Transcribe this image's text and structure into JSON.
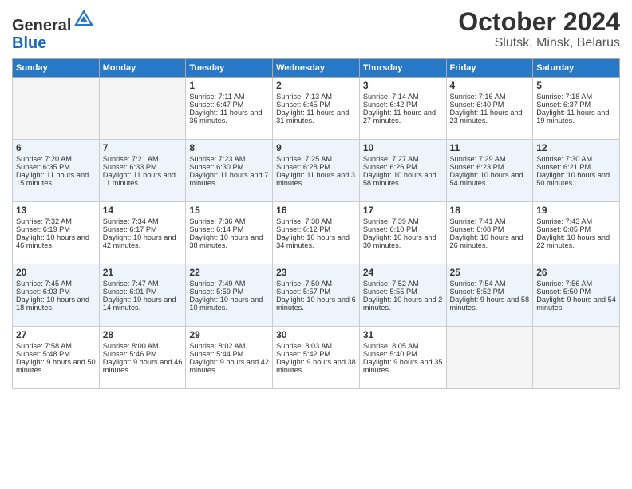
{
  "logo": {
    "general": "General",
    "blue": "Blue"
  },
  "title": "October 2024",
  "subtitle": "Slutsk, Minsk, Belarus",
  "days_header": [
    "Sunday",
    "Monday",
    "Tuesday",
    "Wednesday",
    "Thursday",
    "Friday",
    "Saturday"
  ],
  "weeks": [
    [
      {
        "day": "",
        "content": ""
      },
      {
        "day": "",
        "content": ""
      },
      {
        "day": "1",
        "content": "Sunrise: 7:11 AM\nSunset: 6:47 PM\nDaylight: 11 hours and 36 minutes."
      },
      {
        "day": "2",
        "content": "Sunrise: 7:13 AM\nSunset: 6:45 PM\nDaylight: 11 hours and 31 minutes."
      },
      {
        "day": "3",
        "content": "Sunrise: 7:14 AM\nSunset: 6:42 PM\nDaylight: 11 hours and 27 minutes."
      },
      {
        "day": "4",
        "content": "Sunrise: 7:16 AM\nSunset: 6:40 PM\nDaylight: 11 hours and 23 minutes."
      },
      {
        "day": "5",
        "content": "Sunrise: 7:18 AM\nSunset: 6:37 PM\nDaylight: 11 hours and 19 minutes."
      }
    ],
    [
      {
        "day": "6",
        "content": "Sunrise: 7:20 AM\nSunset: 6:35 PM\nDaylight: 11 hours and 15 minutes."
      },
      {
        "day": "7",
        "content": "Sunrise: 7:21 AM\nSunset: 6:33 PM\nDaylight: 11 hours and 11 minutes."
      },
      {
        "day": "8",
        "content": "Sunrise: 7:23 AM\nSunset: 6:30 PM\nDaylight: 11 hours and 7 minutes."
      },
      {
        "day": "9",
        "content": "Sunrise: 7:25 AM\nSunset: 6:28 PM\nDaylight: 11 hours and 3 minutes."
      },
      {
        "day": "10",
        "content": "Sunrise: 7:27 AM\nSunset: 6:26 PM\nDaylight: 10 hours and 58 minutes."
      },
      {
        "day": "11",
        "content": "Sunrise: 7:29 AM\nSunset: 6:23 PM\nDaylight: 10 hours and 54 minutes."
      },
      {
        "day": "12",
        "content": "Sunrise: 7:30 AM\nSunset: 6:21 PM\nDaylight: 10 hours and 50 minutes."
      }
    ],
    [
      {
        "day": "13",
        "content": "Sunrise: 7:32 AM\nSunset: 6:19 PM\nDaylight: 10 hours and 46 minutes."
      },
      {
        "day": "14",
        "content": "Sunrise: 7:34 AM\nSunset: 6:17 PM\nDaylight: 10 hours and 42 minutes."
      },
      {
        "day": "15",
        "content": "Sunrise: 7:36 AM\nSunset: 6:14 PM\nDaylight: 10 hours and 38 minutes."
      },
      {
        "day": "16",
        "content": "Sunrise: 7:38 AM\nSunset: 6:12 PM\nDaylight: 10 hours and 34 minutes."
      },
      {
        "day": "17",
        "content": "Sunrise: 7:39 AM\nSunset: 6:10 PM\nDaylight: 10 hours and 30 minutes."
      },
      {
        "day": "18",
        "content": "Sunrise: 7:41 AM\nSunset: 6:08 PM\nDaylight: 10 hours and 26 minutes."
      },
      {
        "day": "19",
        "content": "Sunrise: 7:43 AM\nSunset: 6:05 PM\nDaylight: 10 hours and 22 minutes."
      }
    ],
    [
      {
        "day": "20",
        "content": "Sunrise: 7:45 AM\nSunset: 6:03 PM\nDaylight: 10 hours and 18 minutes."
      },
      {
        "day": "21",
        "content": "Sunrise: 7:47 AM\nSunset: 6:01 PM\nDaylight: 10 hours and 14 minutes."
      },
      {
        "day": "22",
        "content": "Sunrise: 7:49 AM\nSunset: 5:59 PM\nDaylight: 10 hours and 10 minutes."
      },
      {
        "day": "23",
        "content": "Sunrise: 7:50 AM\nSunset: 5:57 PM\nDaylight: 10 hours and 6 minutes."
      },
      {
        "day": "24",
        "content": "Sunrise: 7:52 AM\nSunset: 5:55 PM\nDaylight: 10 hours and 2 minutes."
      },
      {
        "day": "25",
        "content": "Sunrise: 7:54 AM\nSunset: 5:52 PM\nDaylight: 9 hours and 58 minutes."
      },
      {
        "day": "26",
        "content": "Sunrise: 7:56 AM\nSunset: 5:50 PM\nDaylight: 9 hours and 54 minutes."
      }
    ],
    [
      {
        "day": "27",
        "content": "Sunrise: 7:58 AM\nSunset: 5:48 PM\nDaylight: 9 hours and 50 minutes."
      },
      {
        "day": "28",
        "content": "Sunrise: 8:00 AM\nSunset: 5:46 PM\nDaylight: 9 hours and 46 minutes."
      },
      {
        "day": "29",
        "content": "Sunrise: 8:02 AM\nSunset: 5:44 PM\nDaylight: 9 hours and 42 minutes."
      },
      {
        "day": "30",
        "content": "Sunrise: 8:03 AM\nSunset: 5:42 PM\nDaylight: 9 hours and 38 minutes."
      },
      {
        "day": "31",
        "content": "Sunrise: 8:05 AM\nSunset: 5:40 PM\nDaylight: 9 hours and 35 minutes."
      },
      {
        "day": "",
        "content": ""
      },
      {
        "day": "",
        "content": ""
      }
    ]
  ]
}
